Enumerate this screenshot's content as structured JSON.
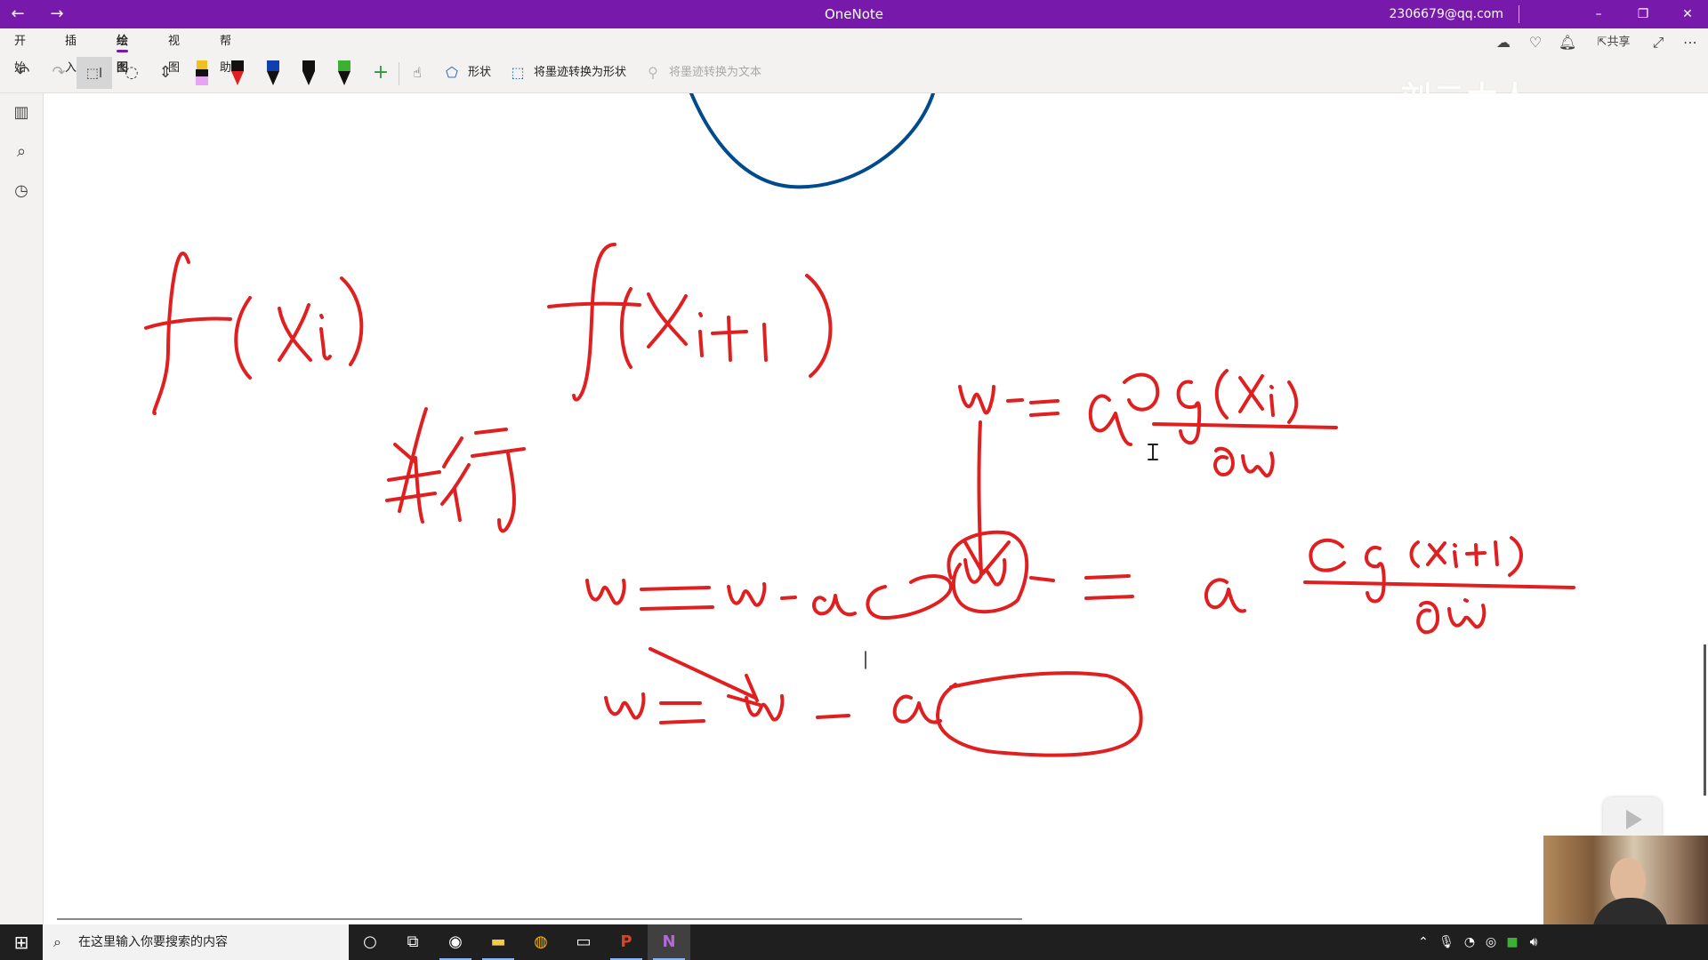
{
  "title_bar": {
    "back_icon": "arrow-left-icon",
    "forward_icon": "arrow-right-icon",
    "app_title": "OneNote",
    "user_email": "2306679@qq.com",
    "minimize_icon": "minimize-icon",
    "restore_icon": "restore-icon",
    "close_icon": "close-icon"
  },
  "ribbon": {
    "tabs": [
      {
        "label": "开始",
        "active": false
      },
      {
        "label": "插入",
        "active": false
      },
      {
        "label": "绘图",
        "active": true
      },
      {
        "label": "视图",
        "active": false
      },
      {
        "label": "帮助",
        "active": false
      }
    ],
    "shape_label": "形状",
    "ink_to_shape_label": "将墨迹转换为形状",
    "ink_to_text_label": "将墨迹转换为文本",
    "share_label": "共享",
    "pens": [
      {
        "name": "highlighter-pen",
        "color": "#e6a5f0",
        "tip": "#111111"
      },
      {
        "name": "red-pen",
        "color": "#e02020",
        "tip": "#e02020"
      },
      {
        "name": "blue-pen",
        "color": "#1030a0",
        "tip": "#1040b0"
      },
      {
        "name": "black-pen",
        "color": "#111111",
        "tip": "#111111"
      },
      {
        "name": "green-pen",
        "color": "#3cb030",
        "tip": "#3cb030"
      }
    ]
  },
  "watermark": "刘二大人",
  "taskbar": {
    "search_placeholder": "在这里输入你要搜索的内容"
  },
  "colors": {
    "accent": "#7719AA",
    "ink_red": "#e02020",
    "ink_blue": "#004b8d"
  }
}
